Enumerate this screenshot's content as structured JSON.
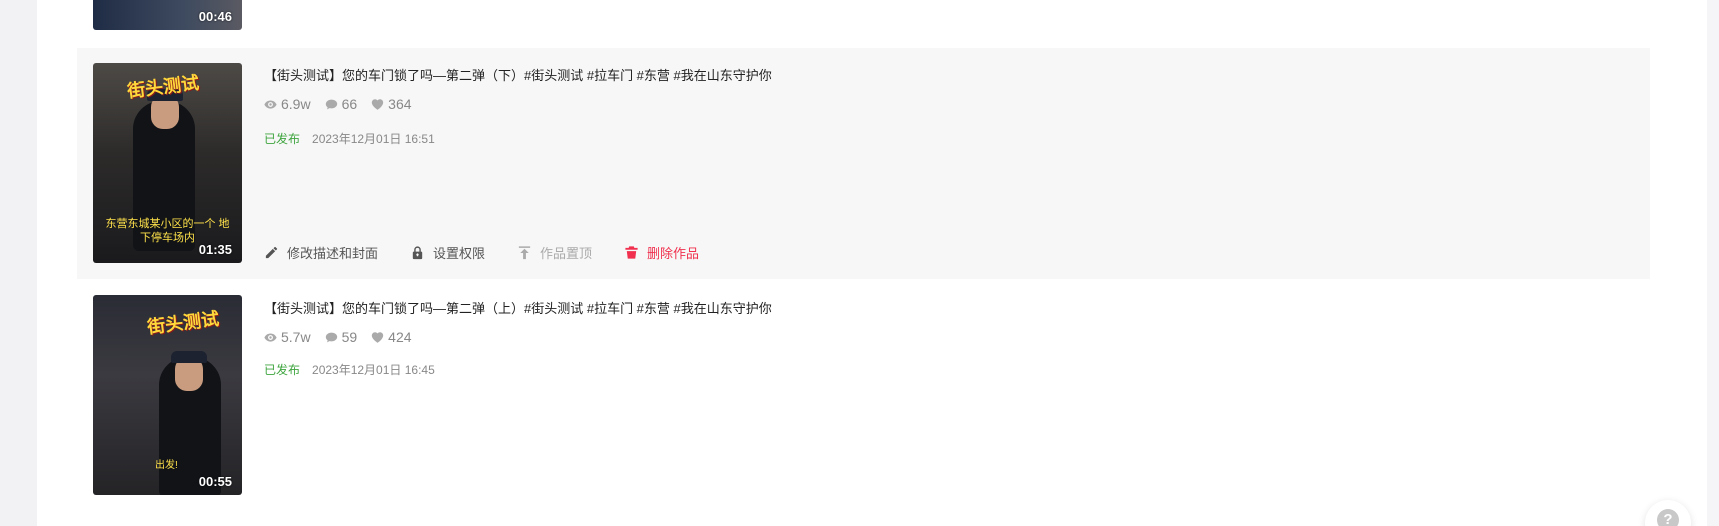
{
  "items": [
    {
      "duration": "00:46"
    },
    {
      "title": "【街头测试】您的车门锁了吗—第二弹（下）#街头测试 #拉车门 #东营 #我在山东守护你",
      "views": "6.9w",
      "comments": "66",
      "likes": "364",
      "status": "已发布",
      "date": "2023年12月01日 16:51",
      "duration": "01:35",
      "thumb_badge": "街头测试",
      "thumb_caption": "东营东城某小区的一个 地下停车场内",
      "actions": {
        "edit": "修改描述和封面",
        "permission": "设置权限",
        "pin": "作品置顶",
        "delete": "删除作品"
      }
    },
    {
      "title": "【街头测试】您的车门锁了吗—第二弹（上）#街头测试 #拉车门 #东营 #我在山东守护你",
      "views": "5.7w",
      "comments": "59",
      "likes": "424",
      "status": "已发布",
      "date": "2023年12月01日 16:45",
      "duration": "00:55",
      "thumb_badge": "街头测试",
      "thumb_caption": "出发!"
    }
  ],
  "help": {
    "label": "?"
  },
  "colors": {
    "status_green": "#3fa53f",
    "danger_red": "#f0304e",
    "hover_bg": "#f7f7f7"
  },
  "icons": {
    "views": "eye-icon",
    "comments": "comment-icon",
    "likes": "heart-icon",
    "edit": "pencil-icon",
    "permission": "lock-icon",
    "pin": "pin-top-icon",
    "delete": "trash-icon",
    "help": "question-icon"
  }
}
